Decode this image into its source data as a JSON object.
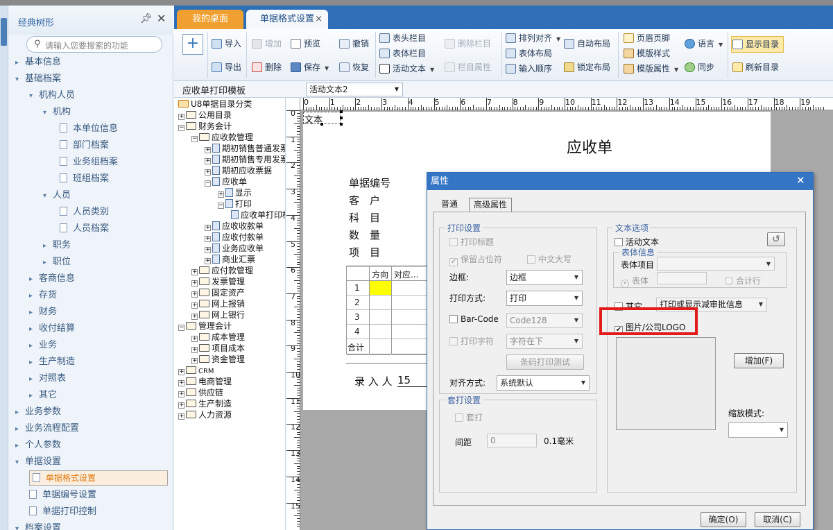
{
  "sidebar": {
    "title": "经典树形",
    "search_placeholder": "请输入您要搜索的功能",
    "items": [
      {
        "label": "基本信息",
        "level": 0,
        "arrow": "▸"
      },
      {
        "label": "基础档案",
        "level": 0,
        "arrow": "▾"
      },
      {
        "label": "机构人员",
        "level": 1,
        "arrow": "▾"
      },
      {
        "label": "机构",
        "level": 2,
        "arrow": "▾"
      },
      {
        "label": "本单位信息",
        "level": 3,
        "doc": true
      },
      {
        "label": "部门档案",
        "level": 3,
        "doc": true
      },
      {
        "label": "业务组档案",
        "level": 3,
        "doc": true
      },
      {
        "label": "班组档案",
        "level": 3,
        "doc": true
      },
      {
        "label": "人员",
        "level": 2,
        "arrow": "▾"
      },
      {
        "label": "人员类别",
        "level": 3,
        "doc": true
      },
      {
        "label": "人员档案",
        "level": 3,
        "doc": true
      },
      {
        "label": "职务",
        "level": 2,
        "arrow": "▸"
      },
      {
        "label": "职位",
        "level": 2,
        "arrow": "▸"
      },
      {
        "label": "客商信息",
        "level": 1,
        "arrow": "▸"
      },
      {
        "label": "存货",
        "level": 1,
        "arrow": "▸"
      },
      {
        "label": "财务",
        "level": 1,
        "arrow": "▸"
      },
      {
        "label": "收付结算",
        "level": 1,
        "arrow": "▸"
      },
      {
        "label": "业务",
        "level": 1,
        "arrow": "▸"
      },
      {
        "label": "生产制造",
        "level": 1,
        "arrow": "▸"
      },
      {
        "label": "对照表",
        "level": 1,
        "arrow": "▸"
      },
      {
        "label": "其它",
        "level": 1,
        "arrow": "▸"
      },
      {
        "label": "业务参数",
        "level": 0,
        "arrow": "▸"
      },
      {
        "label": "业务流程配置",
        "level": 0,
        "arrow": "▸"
      },
      {
        "label": "个人参数",
        "level": 0,
        "arrow": "▸"
      },
      {
        "label": "单据设置",
        "level": 0,
        "arrow": "▾"
      },
      {
        "label": "单据格式设置",
        "level": 1,
        "doc": true,
        "selected": true
      },
      {
        "label": "单据编号设置",
        "level": 1,
        "doc": true
      },
      {
        "label": "单据打印控制",
        "level": 1,
        "doc": true
      },
      {
        "label": "档案设置",
        "level": 0,
        "arrow": "▾"
      }
    ]
  },
  "tabs": {
    "desktop": "我的桌面",
    "format": "单据格式设置"
  },
  "ribbon": {
    "import": "导入",
    "export": "导出",
    "add": "增加",
    "delete": "删除",
    "preview": "预览",
    "save": "保存",
    "undo": "撤销",
    "restore": "恢复",
    "header_col": "表头栏目",
    "body_col": "表体栏目",
    "active_text": "活动文本",
    "del_col": "删除栏目",
    "col_prop": "栏目属性",
    "arrange": "排列对齐",
    "body_layout": "表体布局",
    "input_order": "输入顺序",
    "auto_layout": "自动布局",
    "lock_layout": "锁定布局",
    "header_footer": "页眉页脚",
    "tpl_style": "模版样式",
    "tpl_prop": "模版属性",
    "language": "语言",
    "sync": "同步",
    "show_dir": "显示目录",
    "refresh_dir": "刷新目录"
  },
  "toolbar2": {
    "template": "应收单打印模板",
    "active_select": "活动文本2"
  },
  "tree": [
    {
      "label": "U8单据目录分类",
      "lvl": 0,
      "pm": "",
      "t": "fo"
    },
    {
      "label": "公用目录",
      "lvl": 0,
      "pm": "+",
      "t": "f"
    },
    {
      "label": "财务会计",
      "lvl": 0,
      "pm": "−",
      "t": "f"
    },
    {
      "label": "应收款管理",
      "lvl": 1,
      "pm": "−",
      "t": "f"
    },
    {
      "label": "期初销售普通发票",
      "lvl": 2,
      "pm": "+",
      "t": "p"
    },
    {
      "label": "期初销售专用发票",
      "lvl": 2,
      "pm": "+",
      "t": "p"
    },
    {
      "label": "期初应收票据",
      "lvl": 2,
      "pm": "+",
      "t": "p"
    },
    {
      "label": "应收单",
      "lvl": 2,
      "pm": "−",
      "t": "p"
    },
    {
      "label": "显示",
      "lvl": 3,
      "pm": "+",
      "t": "p"
    },
    {
      "label": "打印",
      "lvl": 3,
      "pm": "−",
      "t": "p"
    },
    {
      "label": "应收单打印模板",
      "lvl": 4,
      "pm": "",
      "t": "p"
    },
    {
      "label": "应收收款单",
      "lvl": 2,
      "pm": "+",
      "t": "p"
    },
    {
      "label": "应收付款单",
      "lvl": 2,
      "pm": "+",
      "t": "p"
    },
    {
      "label": "业务应收单",
      "lvl": 2,
      "pm": "+",
      "t": "p"
    },
    {
      "label": "商业汇票",
      "lvl": 2,
      "pm": "+",
      "t": "p"
    },
    {
      "label": "应付款管理",
      "lvl": 1,
      "pm": "+",
      "t": "f"
    },
    {
      "label": "发票管理",
      "lvl": 1,
      "pm": "+",
      "t": "f"
    },
    {
      "label": "固定资产",
      "lvl": 1,
      "pm": "+",
      "t": "f"
    },
    {
      "label": "网上报销",
      "lvl": 1,
      "pm": "+",
      "t": "f"
    },
    {
      "label": "网上银行",
      "lvl": 1,
      "pm": "+",
      "t": "f"
    },
    {
      "label": "管理会计",
      "lvl": 0,
      "pm": "−",
      "t": "f"
    },
    {
      "label": "成本管理",
      "lvl": 1,
      "pm": "+",
      "t": "f"
    },
    {
      "label": "项目成本",
      "lvl": 1,
      "pm": "+",
      "t": "f"
    },
    {
      "label": "资金管理",
      "lvl": 1,
      "pm": "+",
      "t": "f"
    },
    {
      "label": "CRM",
      "lvl": 0,
      "pm": "+",
      "t": "f"
    },
    {
      "label": "电商管理",
      "lvl": 0,
      "pm": "+",
      "t": "f"
    },
    {
      "label": "供应链",
      "lvl": 0,
      "pm": "+",
      "t": "f"
    },
    {
      "label": "生产制造",
      "lvl": 0,
      "pm": "+",
      "t": "f"
    },
    {
      "label": "人力资源",
      "lvl": 0,
      "pm": "+",
      "t": "f"
    }
  ],
  "designer": {
    "ruler_top": [
      "0",
      "1",
      "2",
      "3",
      "4",
      "5",
      "6",
      "7",
      "8",
      "9",
      "10",
      "11",
      "12",
      "13",
      "14",
      "15",
      "16",
      "17",
      "18",
      "19"
    ],
    "ruler_left": [
      "0",
      "1",
      "2",
      "3",
      "4",
      "5",
      "6",
      "7",
      "8",
      "9",
      "10",
      "11",
      "12",
      "13",
      "14",
      "15"
    ],
    "text_box": "文本",
    "title": "应收单",
    "fields": [
      "单据编号",
      "客　户",
      "科　目",
      "数　量",
      "项　目"
    ],
    "grid_headers": [
      "方向",
      "对应..."
    ],
    "grid_rows": [
      "1",
      "2",
      "3",
      "4",
      "合计"
    ],
    "entry_label": "录 入 人",
    "entry_value": "15"
  },
  "dialog": {
    "title": "属性",
    "tab_normal": "普通",
    "tab_adv": "高级属性",
    "print_group": "打印设置",
    "print_title": "打印标题",
    "keep_placeholder": "保留占位符",
    "cn_upper": "中文大写",
    "border_label": "边框:",
    "border_value": "边框",
    "print_mode_label": "打印方式:",
    "print_mode_value": "打印",
    "barcode": "Bar-Code",
    "barcode_value": "Code128",
    "print_char": "打印字符",
    "char_pos": "字符在下",
    "barcode_test": "条码打印测试",
    "align_label": "对齐方式:",
    "align_value": "系统默认",
    "overlay_group": "套打设置",
    "overlay": "套打",
    "spacing_label": "间距",
    "spacing_value": "0",
    "spacing_unit": "0.1毫米",
    "text_group": "文本选项",
    "active_text": "活动文本",
    "body_info": "表体信息",
    "body_item": "表体项目",
    "body": "表体",
    "total_row": "合计行",
    "other": "其它",
    "other_value": "打印或显示减审批信息",
    "image_logo": "图片/公司LOGO",
    "add": "增加(F)",
    "zoom_mode": "缩放模式:",
    "ok": "确定(O)",
    "cancel": "取消(C)"
  }
}
